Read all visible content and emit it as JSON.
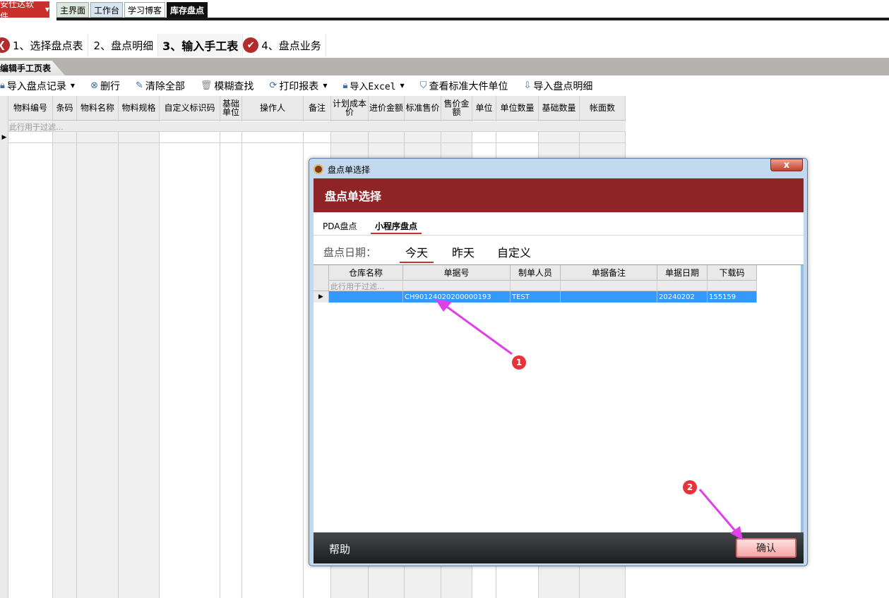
{
  "app": {
    "brand": "安仕达软件"
  },
  "main_tabs": [
    {
      "label": "主界面"
    },
    {
      "label": "工作台"
    },
    {
      "label": "学习博客"
    },
    {
      "label": "库存盘点"
    }
  ],
  "steps": [
    {
      "label": "1、选择盘点表",
      "badge": "‹"
    },
    {
      "label": "2、盘点明细"
    },
    {
      "label": "3、输入手工表"
    },
    {
      "label": "4、盘点业务",
      "badge": "✔"
    }
  ],
  "doc_tab": "编辑手工页表",
  "toolbar": [
    {
      "label": "导入盘点记录",
      "icon": "lock-icon",
      "dropdown": true
    },
    {
      "label": "删行",
      "icon": "delete-circle-icon",
      "dropdown": false
    },
    {
      "label": "清除全部",
      "icon": "pencil-icon",
      "dropdown": false
    },
    {
      "label": "模糊查找",
      "icon": "trash-icon",
      "dropdown": false
    },
    {
      "label": "打印报表",
      "icon": "refresh-icon",
      "dropdown": true
    },
    {
      "label": "导入Excel",
      "icon": "lock-icon",
      "dropdown": true
    },
    {
      "label": "查看标准大件单位",
      "icon": "shield-icon",
      "dropdown": false
    },
    {
      "label": "导入盘点明细",
      "icon": "import-icon",
      "dropdown": false
    }
  ],
  "main_grid": {
    "columns": [
      "物料编号",
      "条码",
      "物料名称",
      "物料规格",
      "自定义标识码",
      "基础单位",
      "操作人",
      "备注",
      "计划成本价",
      "进价金额",
      "标准售价",
      "售价金额",
      "单位",
      "单位数量",
      "基础数量",
      "帐面数"
    ],
    "filter_hint": "此行用于过滤..."
  },
  "dialog": {
    "window_title": "盘点单选择",
    "header": "盘点单选择",
    "close": "x",
    "source_tabs": [
      "PDA盘点",
      "小程序盘点"
    ],
    "active_source_tab": "小程序盘点",
    "date_label": "盘点日期：",
    "date_options": [
      "今天",
      "昨天",
      "自定义"
    ],
    "active_date": "今天",
    "grid": {
      "columns": [
        "仓库名称",
        "单据号",
        "制单人员",
        "单据备注",
        "单据日期",
        "下载码"
      ],
      "filter_hint": "此行用于过滤...",
      "rows": [
        {
          "warehouse": "",
          "doc_no": "CH90124020200000193",
          "creator": "TEST",
          "remark": "",
          "date": "20240202",
          "code": "155159"
        }
      ]
    },
    "footer": {
      "help": "帮助",
      "confirm": "确认"
    }
  },
  "annotations": [
    {
      "label": "1",
      "color": "#e8323a"
    },
    {
      "label": "2",
      "color": "#e8323a"
    }
  ],
  "colors": {
    "accent": "#8e2426",
    "brand": "#c8302c",
    "selection": "#3399ff",
    "arrow": "#e040e8"
  }
}
